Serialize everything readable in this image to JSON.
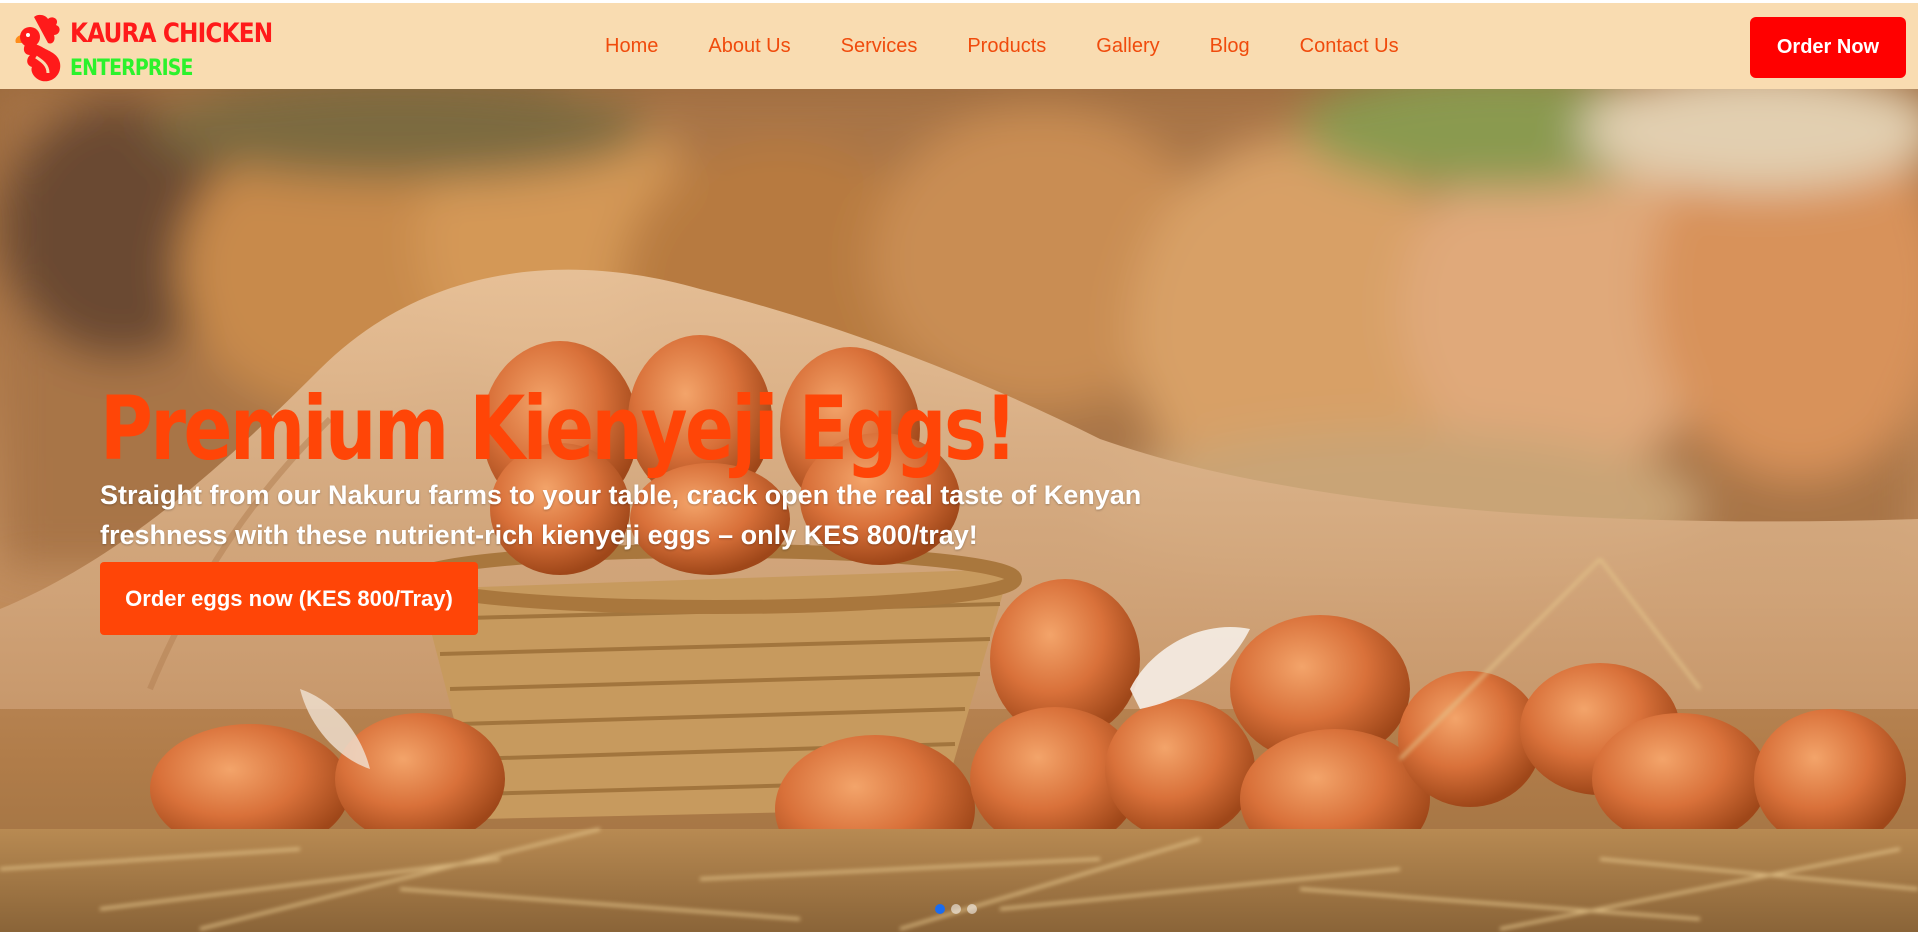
{
  "brand": {
    "line1": "KAURA CHICKEN",
    "line2": "ENTERPRISE",
    "logo_icon": "rooster-icon"
  },
  "nav": {
    "items": [
      {
        "label": "Home"
      },
      {
        "label": "About Us"
      },
      {
        "label": "Services"
      },
      {
        "label": "Products"
      },
      {
        "label": "Gallery"
      },
      {
        "label": "Blog"
      },
      {
        "label": "Contact Us"
      }
    ],
    "order_label": "Order Now"
  },
  "hero": {
    "headline": "Premium Kienyeji Eggs!",
    "subtext": "Straight from our Nakuru farms to your table, crack open the real taste of Kenyan freshness with these nutrient-rich kienyeji eggs – only KES 800/tray!",
    "cta_label": "Order eggs now (KES 800/Tray)",
    "slides_total": 3,
    "active_slide": 1
  },
  "colors": {
    "header_bg": "#f9dcb1",
    "nav_text": "#f04b0c",
    "order_button": "#ff0000",
    "headline": "#ff4507",
    "cta_button": "#ff4507",
    "brand_red": "#ff1a1a",
    "brand_green": "#2cf22c"
  }
}
